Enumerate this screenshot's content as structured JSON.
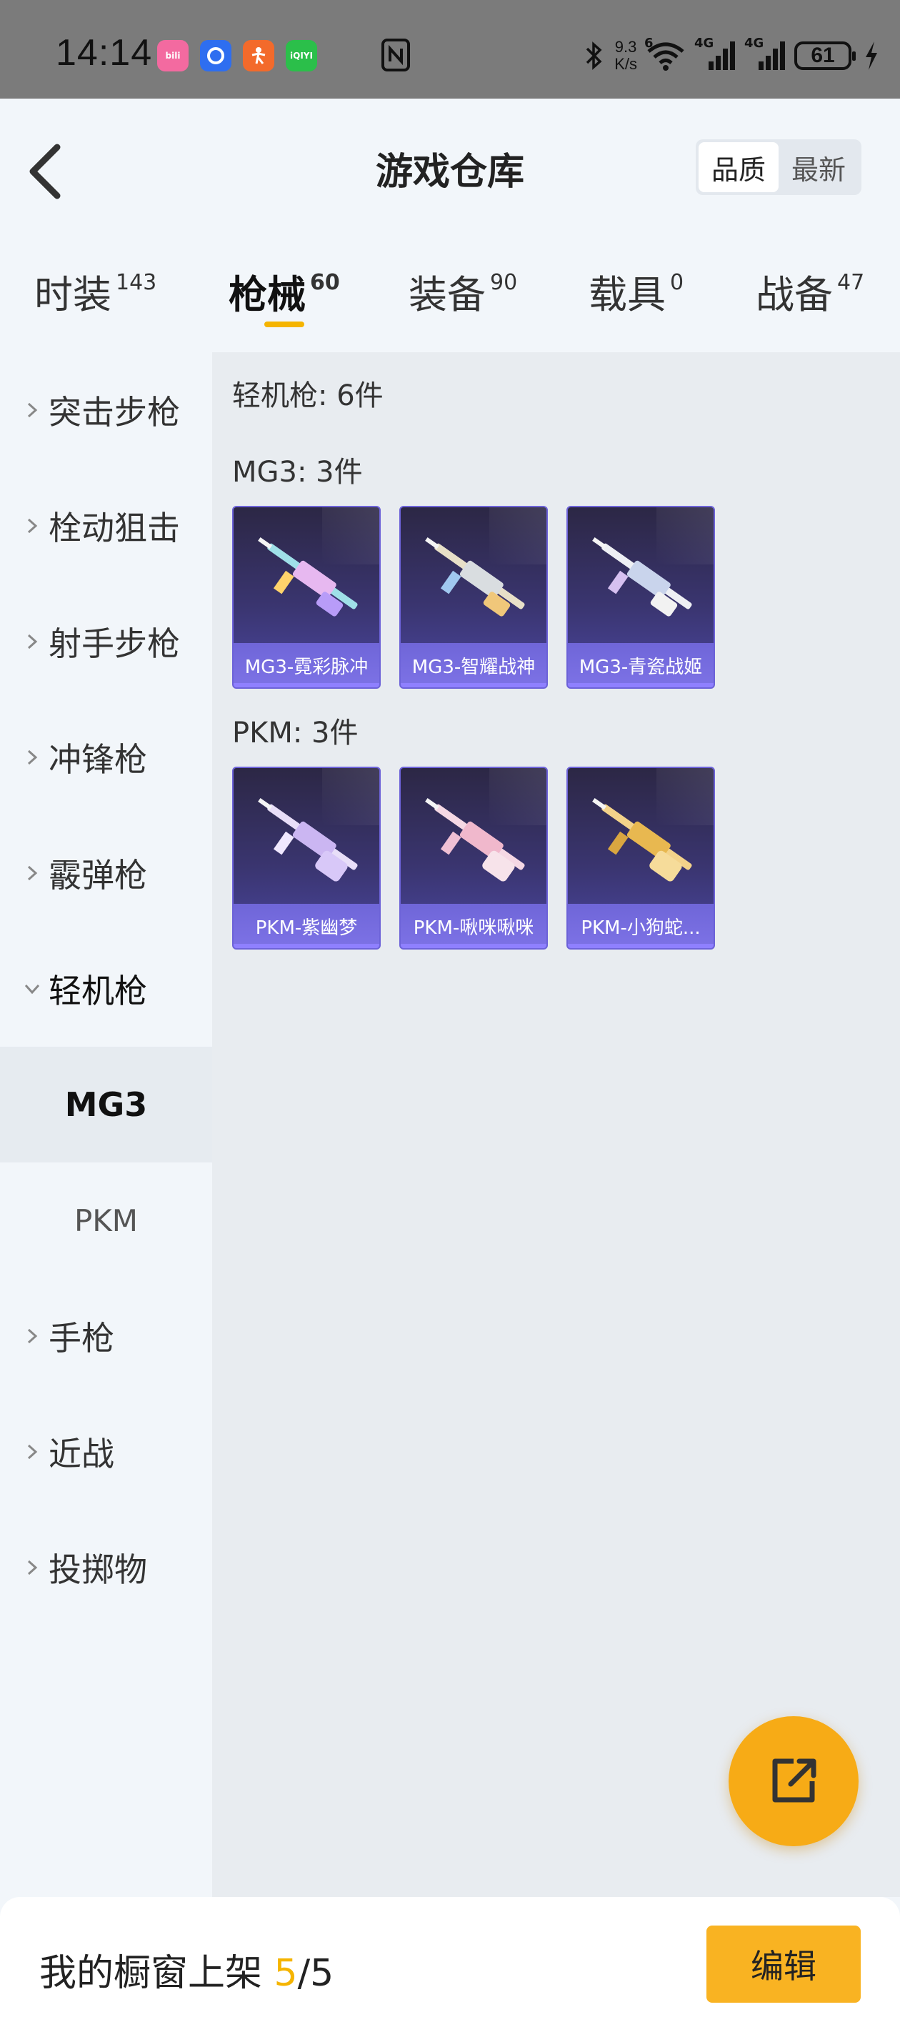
{
  "status_bar": {
    "time": "14:14",
    "net_speed_value": "9.3",
    "net_speed_unit": "K/s",
    "wifi_label": "6",
    "sim1_label": "4G",
    "sim2_label": "4G",
    "battery": "61"
  },
  "header": {
    "title": "游戏仓库",
    "sort_options": [
      "品质",
      "最新"
    ],
    "active_sort": "品质"
  },
  "tabs": [
    {
      "label": "时装",
      "count": "143"
    },
    {
      "label": "枪械",
      "count": "60"
    },
    {
      "label": "装备",
      "count": "90"
    },
    {
      "label": "载具",
      "count": "0"
    },
    {
      "label": "战备",
      "count": "47"
    }
  ],
  "active_tab": "枪械",
  "sidebar": {
    "items": [
      {
        "label": "突击步枪"
      },
      {
        "label": "栓动狙击"
      },
      {
        "label": "射手步枪"
      },
      {
        "label": "冲锋枪"
      },
      {
        "label": "霰弹枪"
      },
      {
        "label": "轻机枪"
      },
      {
        "label": "手枪"
      },
      {
        "label": "近战"
      },
      {
        "label": "投掷物"
      }
    ],
    "sub_items": [
      {
        "label": "MG3"
      },
      {
        "label": "PKM"
      }
    ],
    "selected_sub": "MG3"
  },
  "content": {
    "category_count": "轻机枪: 6件",
    "groups": [
      {
        "title": "MG3: 3件",
        "items": [
          "MG3-霓彩脉冲",
          "MG3-智耀战神",
          "MG3-青瓷战姬"
        ]
      },
      {
        "title": "PKM: 3件",
        "items": [
          "PKM-紫幽梦",
          "PKM-啾咪啾咪",
          "PKM-小狗蛇..."
        ]
      }
    ]
  },
  "bottom": {
    "shelf_prefix": "我的橱窗上架 ",
    "shelf_current": "5",
    "shelf_total": "/5",
    "edit_label": "编辑"
  },
  "colors": {
    "accent": "#f5b400",
    "fab": "#f7ab16",
    "card_label": "#7d72e6"
  }
}
